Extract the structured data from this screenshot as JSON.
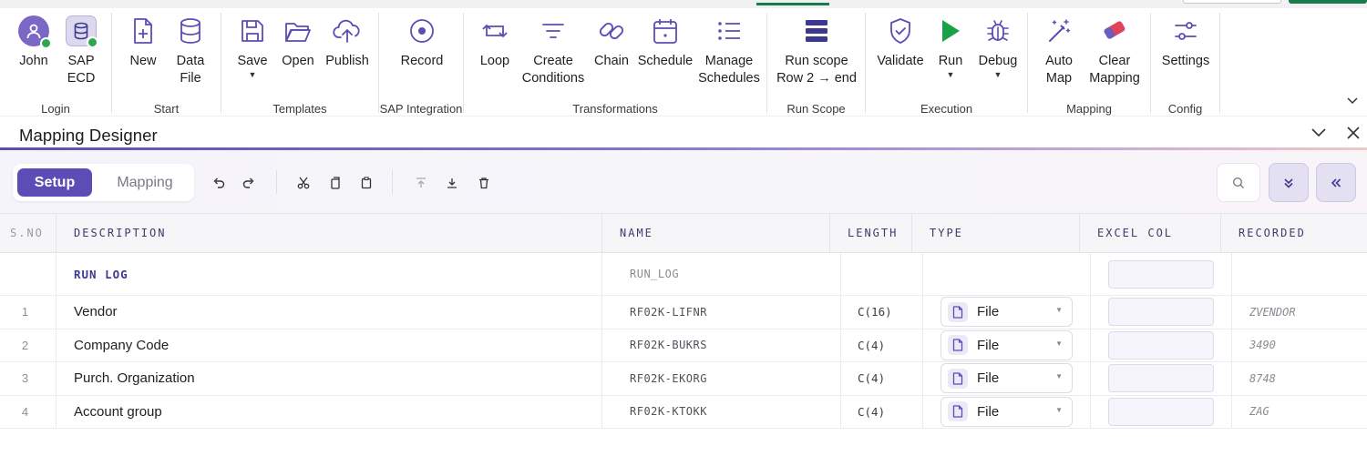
{
  "ribbon": {
    "groups": {
      "login": "Login",
      "start": "Start",
      "templates": "Templates",
      "sap_integration": "SAP Integration",
      "transformations": "Transformations",
      "run_scope": "Run Scope",
      "execution": "Execution",
      "mapping": "Mapping",
      "config": "Config"
    },
    "buttons": {
      "john": "John",
      "sap_ecd_1": "SAP",
      "sap_ecd_2": "ECD",
      "new": "New",
      "data_file_1": "Data",
      "data_file_2": "File",
      "save": "Save",
      "open": "Open",
      "publish": "Publish",
      "record": "Record",
      "loop": "Loop",
      "create_conditions_1": "Create",
      "create_conditions_2": "Conditions",
      "chain": "Chain",
      "schedule": "Schedule",
      "manage_schedules_1": "Manage",
      "manage_schedules_2": "Schedules",
      "run_scope_1": "Run scope",
      "run_scope_2": "Row 2 → end",
      "validate": "Validate",
      "run": "Run",
      "debug": "Debug",
      "auto_map_1": "Auto",
      "auto_map_2": "Map",
      "clear_mapping_1": "Clear",
      "clear_mapping_2": "Mapping",
      "settings": "Settings"
    }
  },
  "pane": {
    "title": "Mapping Designer"
  },
  "toolbar": {
    "setup_tab": "Setup",
    "mapping_tab": "Mapping"
  },
  "grid": {
    "columns": {
      "sno": "S.NO",
      "description": "DESCRIPTION",
      "name": "NAME",
      "length": "LENGTH",
      "type": "TYPE",
      "excel_col": "EXCEL COL",
      "recorded": "RECORDED"
    },
    "run_log": {
      "description": "RUN LOG",
      "name": "RUN_LOG"
    },
    "rows": [
      {
        "sno": "1",
        "description": "Vendor",
        "name": "RF02K-LIFNR",
        "length": "C(16)",
        "type": "File",
        "recorded": "ZVENDOR"
      },
      {
        "sno": "2",
        "description": "Company Code",
        "name": "RF02K-BUKRS",
        "length": "C(4)",
        "type": "File",
        "recorded": "3490"
      },
      {
        "sno": "3",
        "description": "Purch. Organization",
        "name": "RF02K-EKORG",
        "length": "C(4)",
        "type": "File",
        "recorded": "8748"
      },
      {
        "sno": "4",
        "description": "Account group",
        "name": "RF02K-KTOKK",
        "length": "C(4)",
        "type": "File",
        "recorded": "ZAG"
      }
    ]
  },
  "colors": {
    "accent": "#5b4db5",
    "run_green": "#1aa04a",
    "status_online": "#2ea84f"
  }
}
